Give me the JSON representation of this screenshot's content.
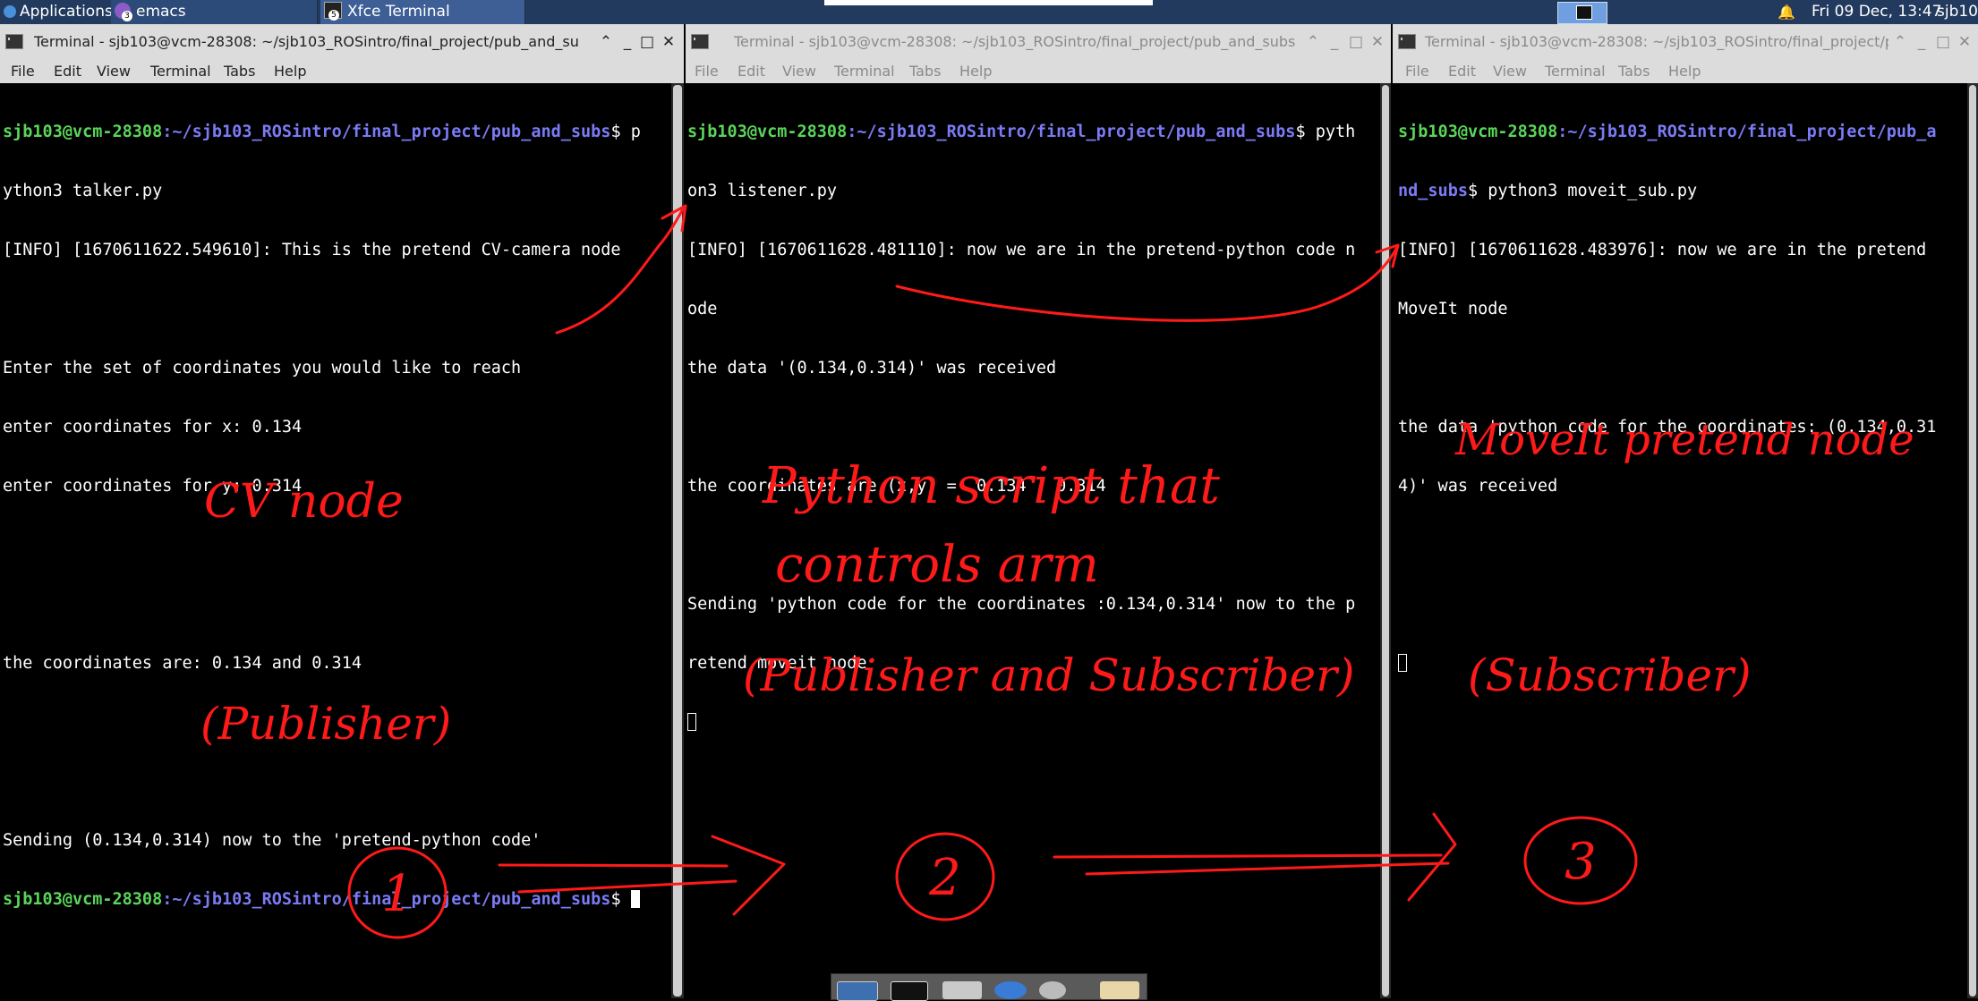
{
  "panel": {
    "applications": "Applications",
    "tasks": [
      {
        "label": "emacs",
        "badge": "3"
      },
      {
        "label": "Xfce Terminal",
        "badge": "5"
      }
    ],
    "clock": "Fri 09 Dec, 13:47",
    "user": "sjb103"
  },
  "menu": [
    "File",
    "Edit",
    "View",
    "Terminal",
    "Tabs",
    "Help"
  ],
  "windows": [
    {
      "title": "Terminal - sjb103@vcm-28308: ~/sjb103_ROSintro/final_project/pub_and_subs",
      "lines": [
        {
          "user": "sjb103@vcm-28308",
          "path": ":~/sjb103_ROSintro/final_project/pub_and_subs",
          "rest": "$ p"
        },
        "ython3 talker.py",
        "[INFO] [1670611622.549610]: This is the pretend CV-camera node",
        "",
        "Enter the set of coordinates you would like to reach",
        "enter coordinates for x: 0.134",
        "enter coordinates for y: 0.314",
        "",
        "",
        "the coordinates are: 0.134 and 0.314",
        "",
        "",
        "Sending (0.134,0.314) now to the 'pretend-python code'",
        {
          "user": "sjb103@vcm-28308",
          "path": ":~/sjb103_ROSintro/final_project/pub_and_subs",
          "rest": "$ "
        }
      ]
    },
    {
      "title": "Terminal - sjb103@vcm-28308: ~/sjb103_ROSintro/final_project/pub_and_subs",
      "lines": [
        {
          "user": "sjb103@vcm-28308",
          "path": ":~/sjb103_ROSintro/final_project/pub_and_subs",
          "rest": "$ pyth"
        },
        "on3 listener.py",
        "[INFO] [1670611628.481110]: now we are in the pretend-python code n",
        "ode",
        "the data '(0.134,0.314)' was received",
        "",
        "the coordinates are (x,y) =  0.134 , 0.314",
        "",
        "Sending 'python code for the coordinates :0.134,0.314' now to the p",
        "retend moveit node",
        ""
      ]
    },
    {
      "title": "Terminal - sjb103@vcm-28308: ~/sjb103_ROSintro/final_project/p",
      "lines": [
        {
          "user": "sjb103@vcm-28308",
          "path": ":~/sjb103_ROSintro/final_project/pub_a",
          "rest": ""
        },
        {
          "user": "",
          "path": "nd_subs",
          "rest": "$ python3 moveit_sub.py"
        },
        "[INFO] [1670611628.483976]: now we are in the pretend",
        "MoveIt node",
        "",
        "the data 'python code for the coordinates: (0.134,0.31",
        "4)' was received",
        "",
        "",
        ""
      ]
    }
  ],
  "annotations": {
    "cv_node": "CV node",
    "publisher": "(Publisher)",
    "python_line1": "Python script that",
    "python_line2": "controls arm",
    "pub_and_sub": "(Publisher and Subscriber)",
    "moveit_node": "MoveIt pretend node",
    "subscriber": "(Subscriber)",
    "step1": "1",
    "step2": "2",
    "step3": "3",
    "color": "#ff1a1a"
  }
}
